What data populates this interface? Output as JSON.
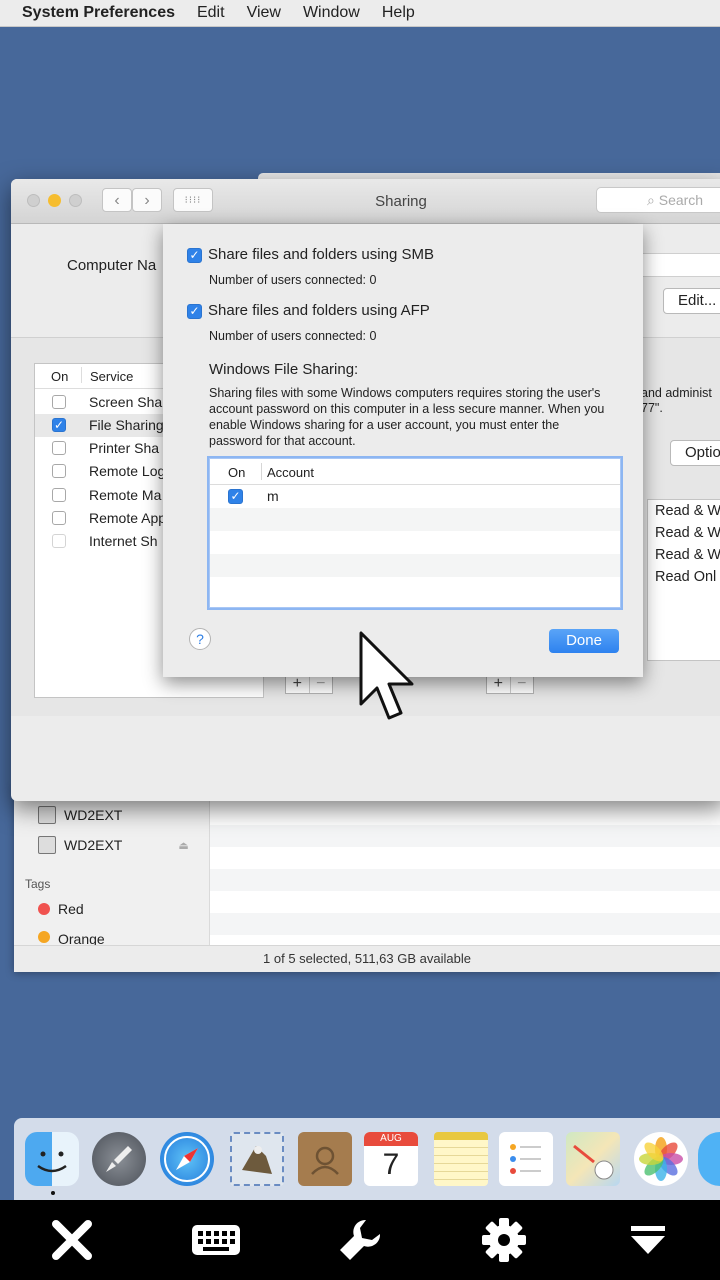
{
  "menubar": {
    "app_name": "System Preferences",
    "items": [
      "Edit",
      "View",
      "Window",
      "Help"
    ]
  },
  "sharing_window": {
    "title": "Sharing",
    "search_placeholder": "Search",
    "computer_name_label": "Computer Na",
    "edit_button": "Edit...",
    "options_button": "Optio",
    "services_header": {
      "on": "On",
      "service": "Service"
    },
    "services": [
      {
        "label": "Screen Sha",
        "checked": false
      },
      {
        "label": "File Sharing",
        "checked": true
      },
      {
        "label": "Printer Sha",
        "checked": false
      },
      {
        "label": "Remote Log",
        "checked": false
      },
      {
        "label": "Remote Ma",
        "checked": false
      },
      {
        "label": "Remote App",
        "checked": false
      },
      {
        "label": "Internet Sh",
        "checked": false
      }
    ],
    "info_line_1": "and administ",
    "info_line_2": "77\".",
    "permissions": [
      "Read & W",
      "Read & W",
      "Read & W",
      "Read Onl"
    ]
  },
  "sheet": {
    "smb_label": "Share files and folders using SMB",
    "smb_checked": true,
    "smb_connected": "Number of users connected: 0",
    "afp_label": "Share files and folders using AFP",
    "afp_checked": true,
    "afp_connected": "Number of users connected: 0",
    "windows_header": "Windows File Sharing:",
    "windows_description": "Sharing files with some Windows computers requires storing the user's account password on this computer in a less secure manner.  When you enable Windows sharing for a user account, you must enter the password for that account.",
    "account_table": {
      "header_on": "On",
      "header_account": "Account",
      "rows": [
        {
          "on": true,
          "account": "m"
        }
      ]
    },
    "help_label": "?",
    "done_button": "Done"
  },
  "finder": {
    "devices": [
      "WD2EXT",
      "WD2EXT"
    ],
    "tags_header": "Tags",
    "tags": [
      {
        "name": "Red",
        "color": "#f0524f"
      },
      {
        "name": "Orange",
        "color": "#f5a623"
      }
    ],
    "status": "1 of 5 selected, 511,63 GB available"
  },
  "dock": {
    "apps": [
      "finder-icon",
      "launchpad-icon",
      "safari-icon",
      "mail-icon",
      "contacts-icon",
      "calendar-icon",
      "notes-icon",
      "reminders-icon",
      "maps-icon",
      "photos-icon",
      "messages-icon"
    ],
    "calendar_month": "AUG",
    "calendar_day": "7"
  },
  "toolbar": {
    "buttons": [
      "close-icon",
      "keyboard-icon",
      "wrench-icon",
      "gear-icon",
      "dropdown-icon"
    ]
  },
  "colors": {
    "desktop": "#47689a",
    "accent": "#2f82e8",
    "toolbar": "#000000"
  }
}
